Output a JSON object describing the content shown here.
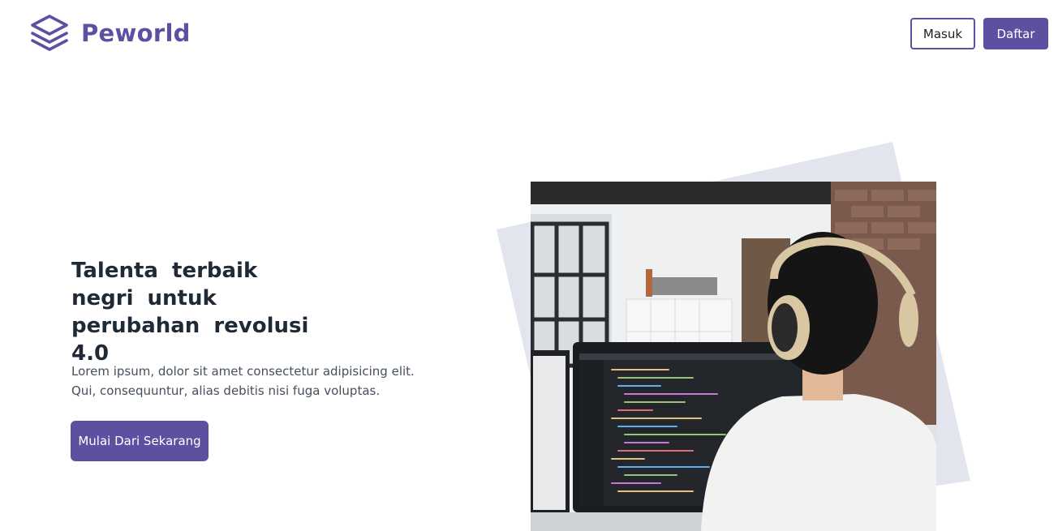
{
  "header": {
    "brand_name": "Peworld",
    "logo_icon": "stacked-layers-icon",
    "login_label": "Masuk",
    "register_label": "Daftar"
  },
  "hero": {
    "title": "Talenta terbaik negri untuk perubahan revolusi 4.0",
    "description": "Lorem ipsum, dolor sit amet consectetur adipisicing elit. Qui, consequuntur, alias debitis nisi fuga voluptas.",
    "cta_label": "Mulai Dari Sekarang"
  },
  "colors": {
    "brand": "#5E50A1",
    "title_text": "#1F2A36",
    "body_text": "#46505C",
    "decor_shape": "#E2E4EE"
  }
}
